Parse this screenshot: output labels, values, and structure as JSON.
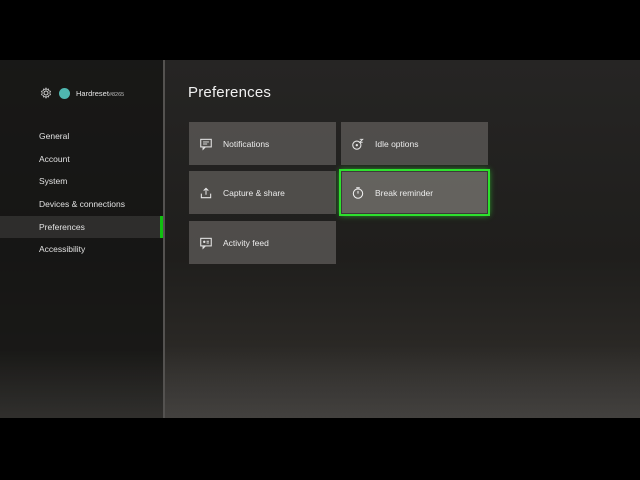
{
  "profile": {
    "gamertag": "Hardreset",
    "gamertag_suffix": "#8265"
  },
  "sidebar": {
    "items": [
      {
        "label": "General"
      },
      {
        "label": "Account"
      },
      {
        "label": "System"
      },
      {
        "label": "Devices & connections"
      },
      {
        "label": "Preferences",
        "selected": true
      },
      {
        "label": "Accessibility"
      }
    ]
  },
  "page": {
    "title": "Preferences"
  },
  "tiles": [
    {
      "label": "Notifications",
      "icon": "notifications-icon"
    },
    {
      "label": "Idle options",
      "icon": "idle-options-icon"
    },
    {
      "label": "Capture & share",
      "icon": "capture-share-icon"
    },
    {
      "label": "Break reminder",
      "icon": "timer-icon",
      "focused": true
    },
    {
      "label": "Activity feed",
      "icon": "activity-feed-icon"
    }
  ],
  "colors": {
    "focus": "#2ee02e",
    "selection_bar": "#10c010",
    "avatar": "#4fb7b0"
  }
}
